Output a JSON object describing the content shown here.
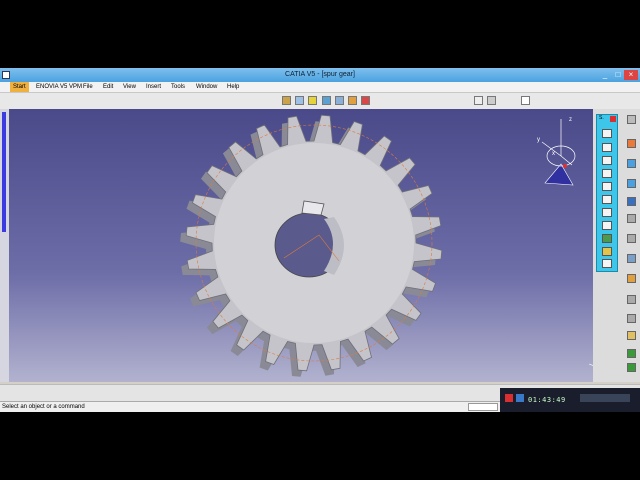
{
  "window": {
    "title": "CATIA V5 - [spur gear]",
    "min": "_",
    "max": "□",
    "close": "×"
  },
  "menu": [
    {
      "label": "Start"
    },
    {
      "label": "ENOVIA V5 VPM"
    },
    {
      "label": "File"
    },
    {
      "label": "Edit"
    },
    {
      "label": "View"
    },
    {
      "label": "Insert"
    },
    {
      "label": "Tools"
    },
    {
      "label": "Window"
    },
    {
      "label": "Help"
    }
  ],
  "compass": {
    "x_label": "x",
    "y_label": "y",
    "z_label": "z"
  },
  "palette": {
    "title": "S."
  },
  "statusbar": {
    "prompt": "Select an object or a command"
  },
  "taskbar": {
    "clock": "01:43:49"
  },
  "colors": {
    "gear_face": "#d2d2d6",
    "gear_teeth": "#c4c4ca",
    "viewport_top": "#4a4a8a",
    "highlight": "#e07a3a"
  },
  "icons": [
    "gear-model",
    "compass-icon",
    "close-icon"
  ]
}
